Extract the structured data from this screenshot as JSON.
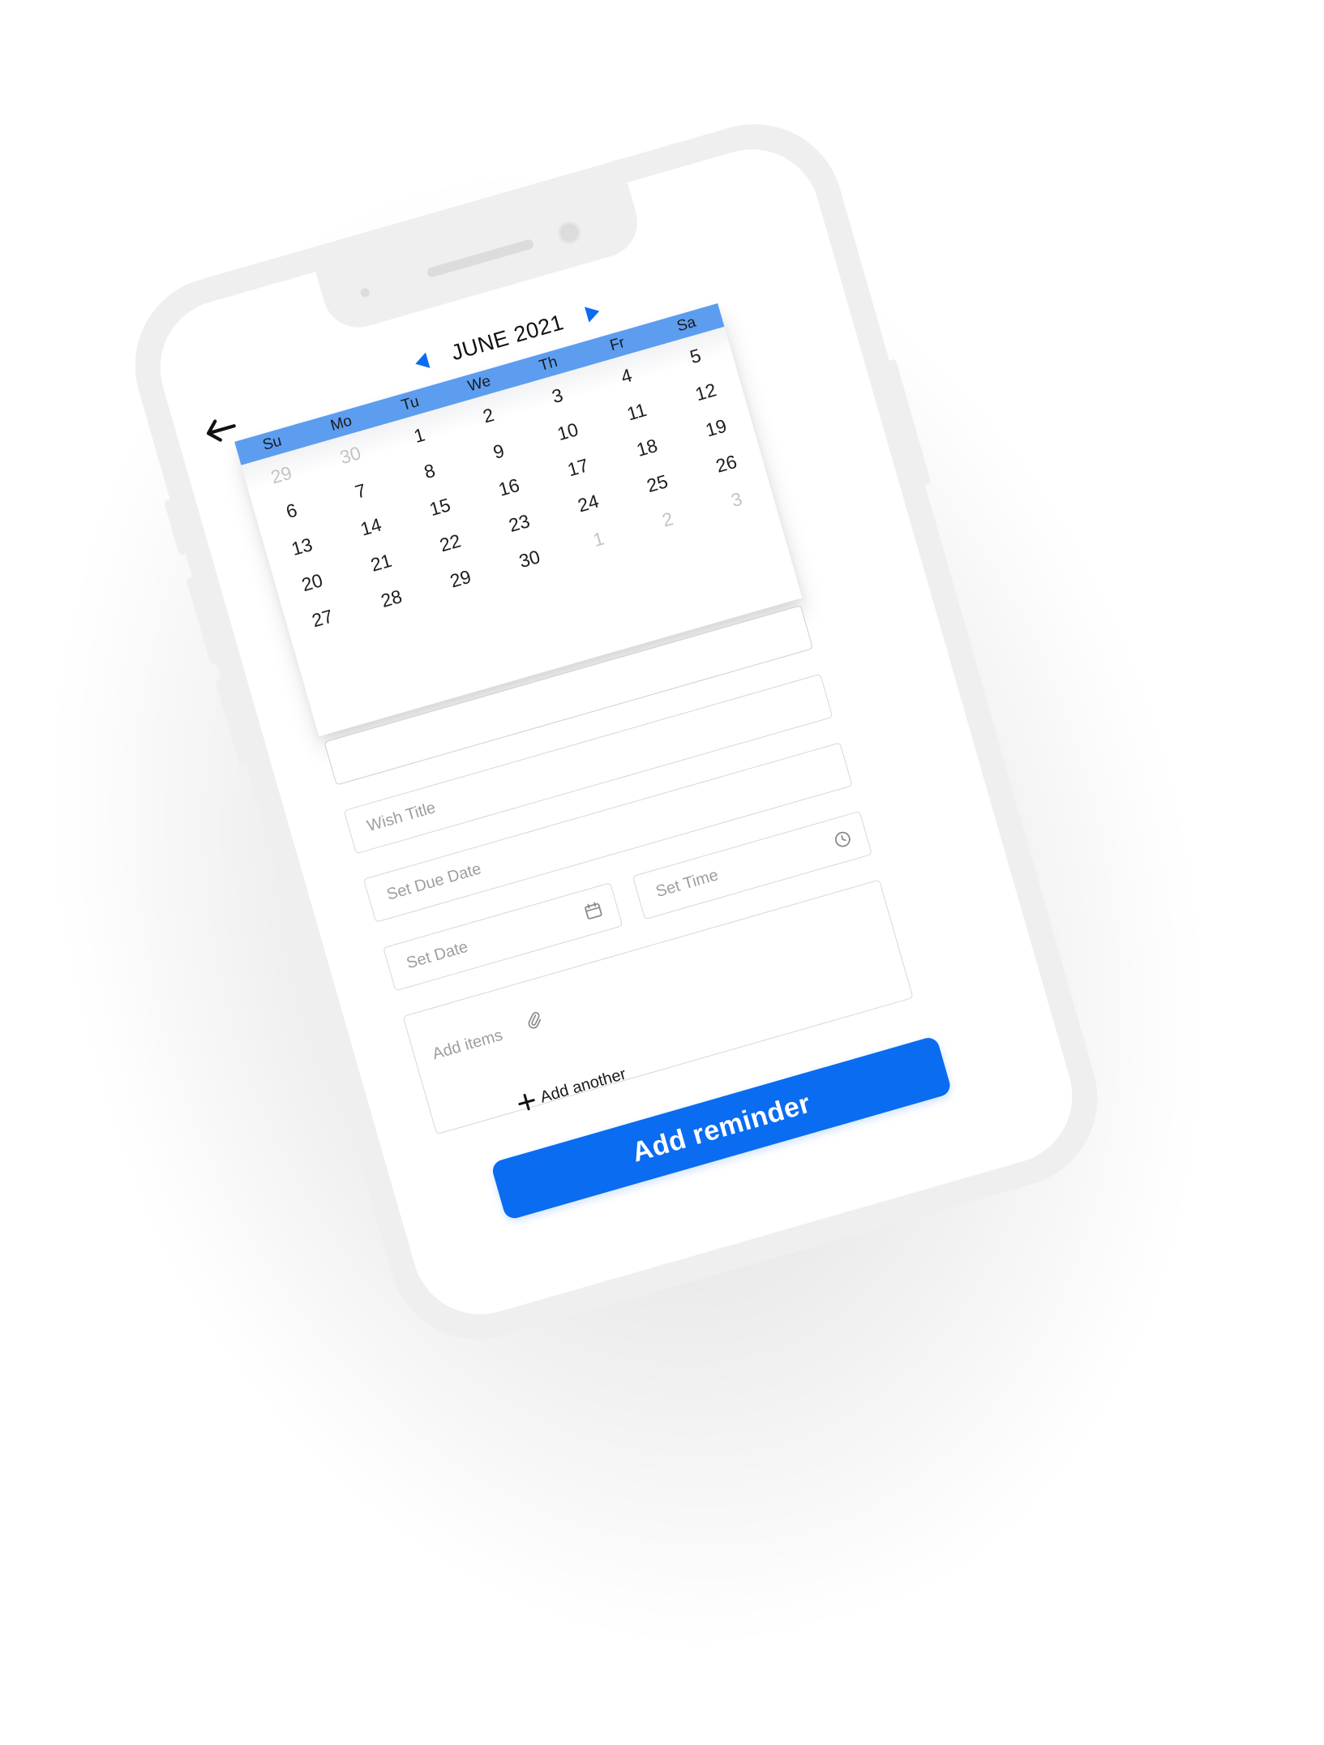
{
  "calendar": {
    "month_label": "JUNE 2021",
    "weekdays": [
      "Su",
      "Mo",
      "Tu",
      "We",
      "Th",
      "Fr",
      "Sa"
    ],
    "days": [
      {
        "label": "29",
        "muted": true
      },
      {
        "label": "30",
        "muted": true
      },
      {
        "label": "1",
        "muted": false
      },
      {
        "label": "2",
        "muted": false
      },
      {
        "label": "3",
        "muted": false
      },
      {
        "label": "4",
        "muted": false
      },
      {
        "label": "5",
        "muted": false
      },
      {
        "label": "6",
        "muted": false
      },
      {
        "label": "7",
        "muted": false
      },
      {
        "label": "8",
        "muted": false
      },
      {
        "label": "9",
        "muted": false
      },
      {
        "label": "10",
        "muted": false
      },
      {
        "label": "11",
        "muted": false
      },
      {
        "label": "12",
        "muted": false
      },
      {
        "label": "13",
        "muted": false
      },
      {
        "label": "14",
        "muted": false
      },
      {
        "label": "15",
        "muted": false
      },
      {
        "label": "16",
        "muted": false
      },
      {
        "label": "17",
        "muted": false
      },
      {
        "label": "18",
        "muted": false
      },
      {
        "label": "19",
        "muted": false
      },
      {
        "label": "20",
        "muted": false
      },
      {
        "label": "21",
        "muted": false
      },
      {
        "label": "22",
        "muted": false
      },
      {
        "label": "23",
        "muted": false
      },
      {
        "label": "24",
        "muted": false
      },
      {
        "label": "25",
        "muted": false
      },
      {
        "label": "26",
        "muted": false
      },
      {
        "label": "27",
        "muted": false
      },
      {
        "label": "28",
        "muted": false
      },
      {
        "label": "29",
        "muted": false
      },
      {
        "label": "30",
        "muted": false
      },
      {
        "label": "1",
        "muted": true
      },
      {
        "label": "2",
        "muted": true
      },
      {
        "label": "3",
        "muted": true
      }
    ]
  },
  "form": {
    "wish_title_placeholder": "Wish Title",
    "due_date_placeholder": "Set Due Date",
    "date_placeholder": "Set Date",
    "time_placeholder": "Set Time",
    "items_placeholder": "Add items",
    "add_another_label": "Add another",
    "submit_label": "Add reminder"
  },
  "icons": {
    "back": "arrow-left-icon",
    "prev_month": "triangle-left-icon",
    "next_month": "triangle-right-icon",
    "calendar": "calendar-icon",
    "clock": "clock-icon",
    "attachment": "paperclip-icon",
    "add": "plus-icon"
  },
  "colors": {
    "accent": "#0a6cf1",
    "weekday_bar": "#5c9df0",
    "muted_day": "#c4c4c4",
    "device_frame": "#efefef"
  }
}
